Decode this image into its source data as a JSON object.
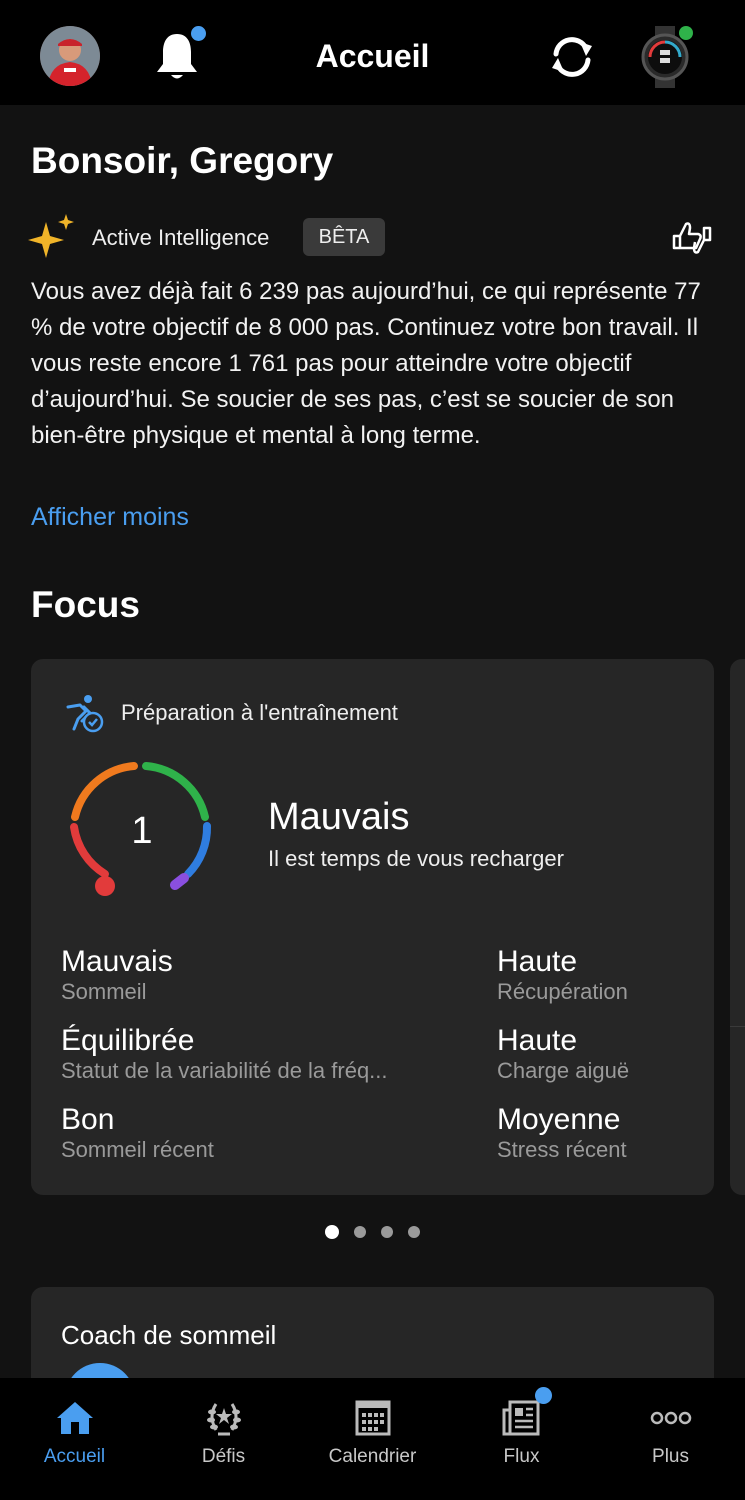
{
  "header": {
    "title": "Accueil",
    "avatar_icon": "user-avatar",
    "notification_icon": "bell-icon",
    "sync_icon": "sync-icon",
    "device_icon": "watch-icon",
    "notification_dot_color": "#4a9ef0",
    "device_status_color": "#2fb24a"
  },
  "greeting": "Bonsoir, Gregory",
  "active_intelligence": {
    "label": "Active Intelligence",
    "badge": "BÊTA",
    "summary": "Vous avez déjà fait 6 239 pas aujourd’hui, ce qui représente 77 % de votre objectif de 8 000 pas. Continuez votre bon travail. Il vous reste encore 1 761 pas pour atteindre votre objectif d’aujourd’hui. Se soucier de ses pas, c’est se soucier de son bien-être physique et mental à long terme.",
    "toggle_link": "Afficher moins"
  },
  "focus": {
    "heading": "Focus",
    "card": {
      "title": "Préparation à l'entraînement",
      "score": "1",
      "status": "Mauvais",
      "status_sub": "Il est temps de vous recharger",
      "metrics_left": [
        {
          "value": "Mauvais",
          "label": "Sommeil"
        },
        {
          "value": "Équilibrée",
          "label": "Statut de la variabilité de la fréq..."
        },
        {
          "value": "Bon",
          "label": "Sommeil récent"
        }
      ],
      "metrics_right": [
        {
          "value": "Haute",
          "label": "Récupération"
        },
        {
          "value": "Haute",
          "label": "Charge aiguë"
        },
        {
          "value": "Moyenne",
          "label": "Stress récent"
        }
      ]
    },
    "carousel_pages": 4,
    "carousel_active": 1
  },
  "sleep_coach": {
    "title": "Coach de sommeil"
  },
  "bottom_nav": [
    {
      "label": "Accueil",
      "icon": "home-icon",
      "active": true
    },
    {
      "label": "Défis",
      "icon": "laurel-icon",
      "active": false
    },
    {
      "label": "Calendrier",
      "icon": "calendar-icon",
      "active": false
    },
    {
      "label": "Flux",
      "icon": "newsfeed-icon",
      "active": false
    },
    {
      "label": "Plus",
      "icon": "more-icon",
      "active": false
    }
  ],
  "colors": {
    "accent": "#4a9ef0",
    "gauge": [
      "#e23b3b",
      "#f07a1e",
      "#2fb24a",
      "#2f7de0",
      "#8a4fe0"
    ]
  }
}
